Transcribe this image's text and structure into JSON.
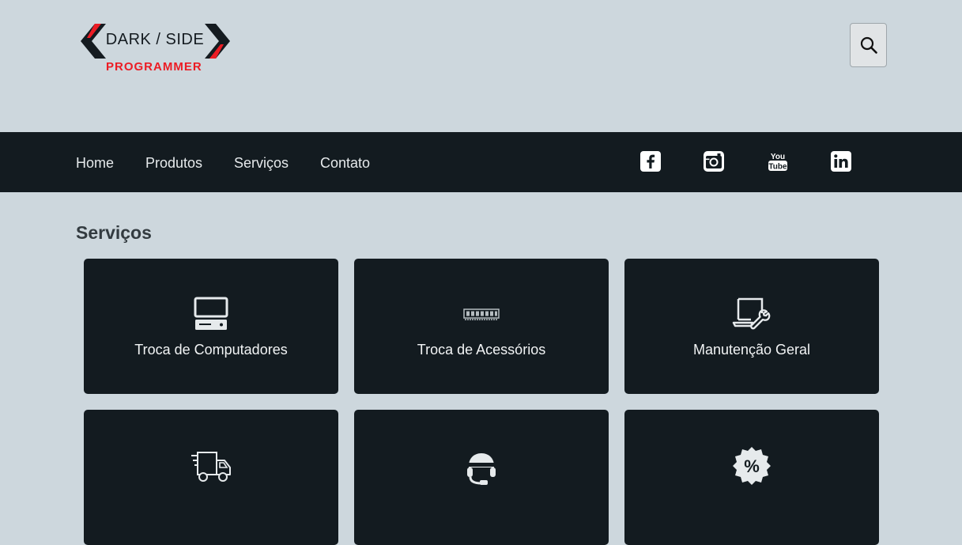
{
  "header": {
    "logo_text_top": "DARK / SIDE",
    "logo_text_bottom": "PROGRAMMER",
    "search_icon": "search-icon"
  },
  "nav": {
    "links": [
      "Home",
      "Produtos",
      "Serviços",
      "Contato"
    ],
    "social": [
      "facebook-icon",
      "instagram-icon",
      "youtube-icon",
      "linkedin-icon"
    ]
  },
  "main": {
    "title": "Serviços",
    "services": [
      {
        "label": "Troca de Computadores",
        "icon": "desktop-computer-icon"
      },
      {
        "label": "Troca de Acessórios",
        "icon": "memory-module-icon"
      },
      {
        "label": "Manutenção Geral",
        "icon": "laptop-wrench-icon"
      },
      {
        "label": "",
        "icon": "delivery-truck-icon"
      },
      {
        "label": "",
        "icon": "support-headset-icon"
      },
      {
        "label": "",
        "icon": "discount-badge-icon"
      }
    ]
  },
  "colors": {
    "background": "#cdd7dd",
    "navbar": "#131b20",
    "card": "#131b20",
    "logo_red": "#ec1c24"
  }
}
